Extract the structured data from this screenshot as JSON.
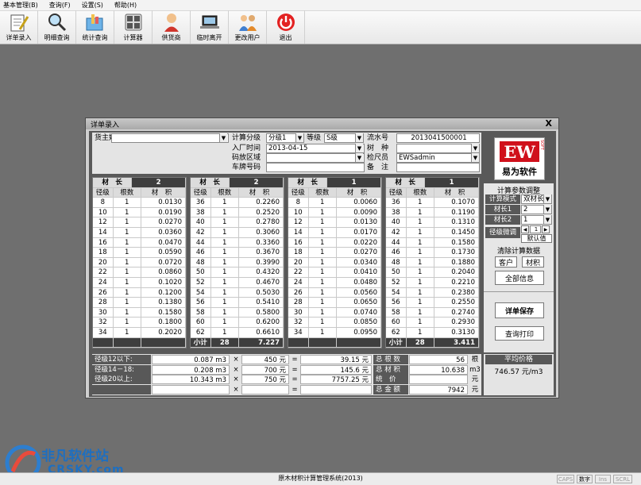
{
  "menu": [
    "基本管理(B)",
    "查询(F)",
    "设置(S)",
    "帮助(H)"
  ],
  "toolbar": [
    {
      "label": "详单录入",
      "icon": "pen-notepad-icon"
    },
    {
      "label": "明细查询",
      "icon": "magnifier-icon"
    },
    {
      "label": "统计查询",
      "icon": "folder-chart-icon"
    },
    {
      "label": "计算器",
      "icon": "calculator-icon"
    },
    {
      "label": "供货商",
      "icon": "supplier-person-icon"
    },
    {
      "label": "临时离开",
      "icon": "laptop-icon"
    },
    {
      "label": "更改用户",
      "icon": "users-icon"
    },
    {
      "label": "退出",
      "icon": "power-icon"
    }
  ],
  "dialog": {
    "title": "详单录入",
    "close": "X",
    "header": {
      "owner_label": "货主姓名",
      "owner_value": "",
      "calc_level_label": "计算分级",
      "calc_level_value": "分级1",
      "grade_label": "等级",
      "grade_value": "S级",
      "serial_label": "流水号",
      "serial_value": "2013041500001",
      "date_label": "入厂时间",
      "date_value": "2013-04-15",
      "species_label": "树　种",
      "species_value": "",
      "yard_label": "码放区域",
      "yard_value": "",
      "inspector_label": "检尺员",
      "inspector_value": "EWSadmin",
      "plate_label": "车牌号码",
      "plate_value": "",
      "remark_label": "备　注",
      "remark_value": ""
    },
    "logo": {
      "brand": "EW",
      "brand_side": "SOFT",
      "name": "易为软件"
    },
    "grid_labels": {
      "length": "材　长",
      "diameter": "径级",
      "count": "根数",
      "volume": "材　积",
      "subtotal": "小计"
    },
    "grids": [
      {
        "length": "2",
        "rows": [
          [
            "8",
            "1",
            "0.0130"
          ],
          [
            "10",
            "1",
            "0.0190"
          ],
          [
            "12",
            "1",
            "0.0270"
          ],
          [
            "14",
            "1",
            "0.0360"
          ],
          [
            "16",
            "1",
            "0.0470"
          ],
          [
            "18",
            "1",
            "0.0590"
          ],
          [
            "20",
            "1",
            "0.0720"
          ],
          [
            "22",
            "1",
            "0.0860"
          ],
          [
            "24",
            "1",
            "0.1020"
          ],
          [
            "26",
            "1",
            "0.1200"
          ],
          [
            "28",
            "1",
            "0.1380"
          ],
          [
            "30",
            "1",
            "0.1580"
          ],
          [
            "32",
            "1",
            "0.1800"
          ],
          [
            "34",
            "1",
            "0.2020"
          ]
        ],
        "subtotal": [
          "",
          "",
          ""
        ]
      },
      {
        "length": "2",
        "rows": [
          [
            "36",
            "1",
            "0.2260"
          ],
          [
            "38",
            "1",
            "0.2520"
          ],
          [
            "40",
            "1",
            "0.2780"
          ],
          [
            "42",
            "1",
            "0.3060"
          ],
          [
            "44",
            "1",
            "0.3360"
          ],
          [
            "46",
            "1",
            "0.3670"
          ],
          [
            "48",
            "1",
            "0.3990"
          ],
          [
            "50",
            "1",
            "0.4320"
          ],
          [
            "52",
            "1",
            "0.4670"
          ],
          [
            "54",
            "1",
            "0.5030"
          ],
          [
            "56",
            "1",
            "0.5410"
          ],
          [
            "58",
            "1",
            "0.5800"
          ],
          [
            "60",
            "1",
            "0.6200"
          ],
          [
            "62",
            "1",
            "0.6610"
          ]
        ],
        "subtotal": [
          "小计",
          "28",
          "7.227"
        ]
      },
      {
        "length": "1",
        "rows": [
          [
            "8",
            "1",
            "0.0060"
          ],
          [
            "10",
            "1",
            "0.0090"
          ],
          [
            "12",
            "1",
            "0.0130"
          ],
          [
            "14",
            "1",
            "0.0170"
          ],
          [
            "16",
            "1",
            "0.0220"
          ],
          [
            "18",
            "1",
            "0.0270"
          ],
          [
            "20",
            "1",
            "0.0340"
          ],
          [
            "22",
            "1",
            "0.0410"
          ],
          [
            "24",
            "1",
            "0.0480"
          ],
          [
            "26",
            "1",
            "0.0560"
          ],
          [
            "28",
            "1",
            "0.0650"
          ],
          [
            "30",
            "1",
            "0.0740"
          ],
          [
            "32",
            "1",
            "0.0850"
          ],
          [
            "34",
            "1",
            "0.0950"
          ]
        ],
        "subtotal": [
          "",
          "",
          ""
        ]
      },
      {
        "length": "1",
        "rows": [
          [
            "36",
            "1",
            "0.1070"
          ],
          [
            "38",
            "1",
            "0.1190"
          ],
          [
            "40",
            "1",
            "0.1310"
          ],
          [
            "42",
            "1",
            "0.1450"
          ],
          [
            "44",
            "1",
            "0.1580"
          ],
          [
            "46",
            "1",
            "0.1730"
          ],
          [
            "48",
            "1",
            "0.1880"
          ],
          [
            "50",
            "1",
            "0.2040"
          ],
          [
            "52",
            "1",
            "0.2210"
          ],
          [
            "54",
            "1",
            "0.2380"
          ],
          [
            "56",
            "1",
            "0.2550"
          ],
          [
            "58",
            "1",
            "0.2740"
          ],
          [
            "60",
            "1",
            "0.2930"
          ],
          [
            "62",
            "1",
            "0.3130"
          ]
        ],
        "subtotal": [
          "小计",
          "28",
          "3.411"
        ]
      }
    ],
    "side": {
      "params_title": "计算参数调整",
      "mode_label": "计算模式",
      "mode_value": "双材长",
      "len1_label": "材长1",
      "len1_value": "2",
      "len2_label": "材长2",
      "len2_value": "1",
      "fine_label": "径级微调",
      "fine_value": "1",
      "default_btn": "默认值",
      "clear_title": "清除计算数据",
      "customer_btn": "客户",
      "volume_btn": "材积",
      "all_btn": "全部信息",
      "save_btn": "详单保存",
      "print_btn": "查询打印"
    },
    "summary": {
      "rows": [
        {
          "label": "径级12以下:",
          "vol": "0.087 m3",
          "x": "×",
          "price": "450 元",
          "eq": "=",
          "amount": "39.15 元"
        },
        {
          "label": "径级14－18:",
          "vol": "0.208 m3",
          "x": "×",
          "price": "700 元",
          "eq": "=",
          "amount": "145.6 元"
        },
        {
          "label": "径级20以上:",
          "vol": "10.343 m3",
          "x": "×",
          "price": "750 元",
          "eq": "=",
          "amount": "7757.25 元"
        },
        {
          "label": "",
          "vol": "",
          "x": "×",
          "price": "",
          "eq": "=",
          "amount": ""
        }
      ],
      "totals": [
        {
          "label": "总 根 数",
          "value": "56",
          "unit": "根"
        },
        {
          "label": "总 材 积",
          "value": "10.638",
          "unit": "m3"
        },
        {
          "label": "统　价",
          "value": "",
          "unit": "元"
        },
        {
          "label": "总 金 额",
          "value": "7942",
          "unit": "元"
        }
      ],
      "avg_label": "平均价格",
      "avg_value": "746.57 元/m3"
    }
  },
  "statusbar": {
    "title": "原木材积计算管理系统(2013)",
    "keys": [
      "CAPS",
      "数字",
      "Ins",
      "SCRL"
    ]
  },
  "watermark": {
    "cn": "非凡软件站",
    "en": "CRSKY.com"
  }
}
